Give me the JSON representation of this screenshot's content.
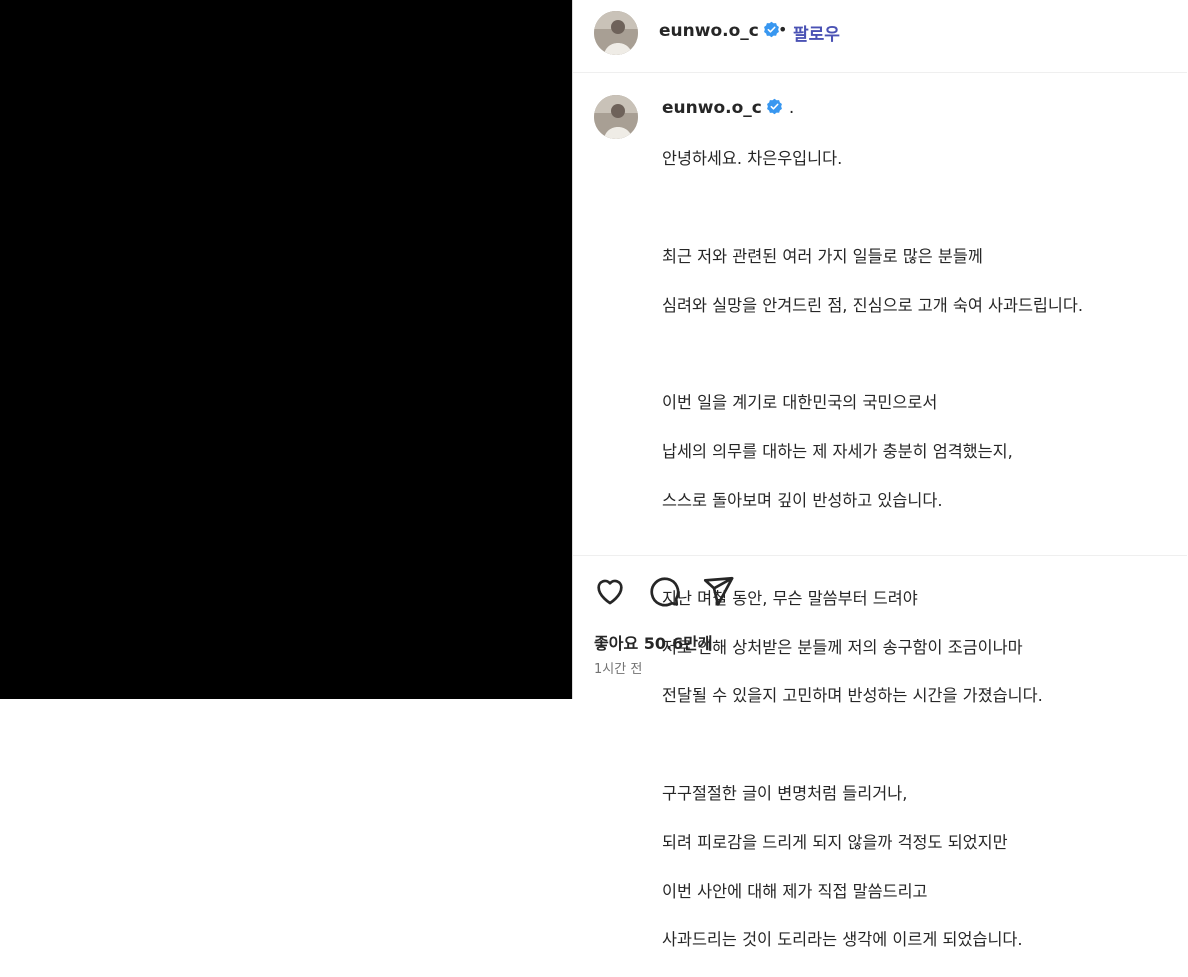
{
  "post": {
    "username": "eunwo.o_c",
    "follow_label": "팔로우",
    "caption_suffix": ".",
    "caption_lines": [
      "안녕하세요. 차은우입니다.",
      "",
      "최근 저와 관련된 여러 가지 일들로 많은 분들께",
      "심려와 실망을 안겨드린 점, 진심으로 고개 숙여 사과드립니다.",
      "",
      "이번 일을 계기로 대한민국의 국민으로서",
      "납세의 의무를 대하는 제 자세가 충분히 엄격했는지,",
      "스스로 돌아보며 깊이 반성하고 있습니다.",
      "",
      "지난 며칠 동안, 무슨 말씀부터 드려야",
      "저로 인해 상처받은 분들께 저의 송구함이 조금이나마",
      "전달될 수 있을지 고민하며 반성하는 시간을 가졌습니다.",
      "",
      "구구절절한 글이 변명처럼 들리거나,",
      "되려 피로감을 드리게 되지 않을까 걱정도 되었지만",
      "이번 사안에 대해 제가 직접 말씀드리고",
      "사과드리는 것이 도리라는 생각에 이르게 되었습니다."
    ],
    "likes_text": "좋아요 50.6만개",
    "timestamp": "1시간 전"
  },
  "icons": {
    "verified": "verified-badge-icon",
    "like": "heart-icon",
    "comment": "comment-bubble-icon",
    "share": "paper-plane-icon"
  },
  "colors": {
    "follow": "#4a52b4",
    "verified": "#3897f0",
    "media_bg": "#000000"
  }
}
